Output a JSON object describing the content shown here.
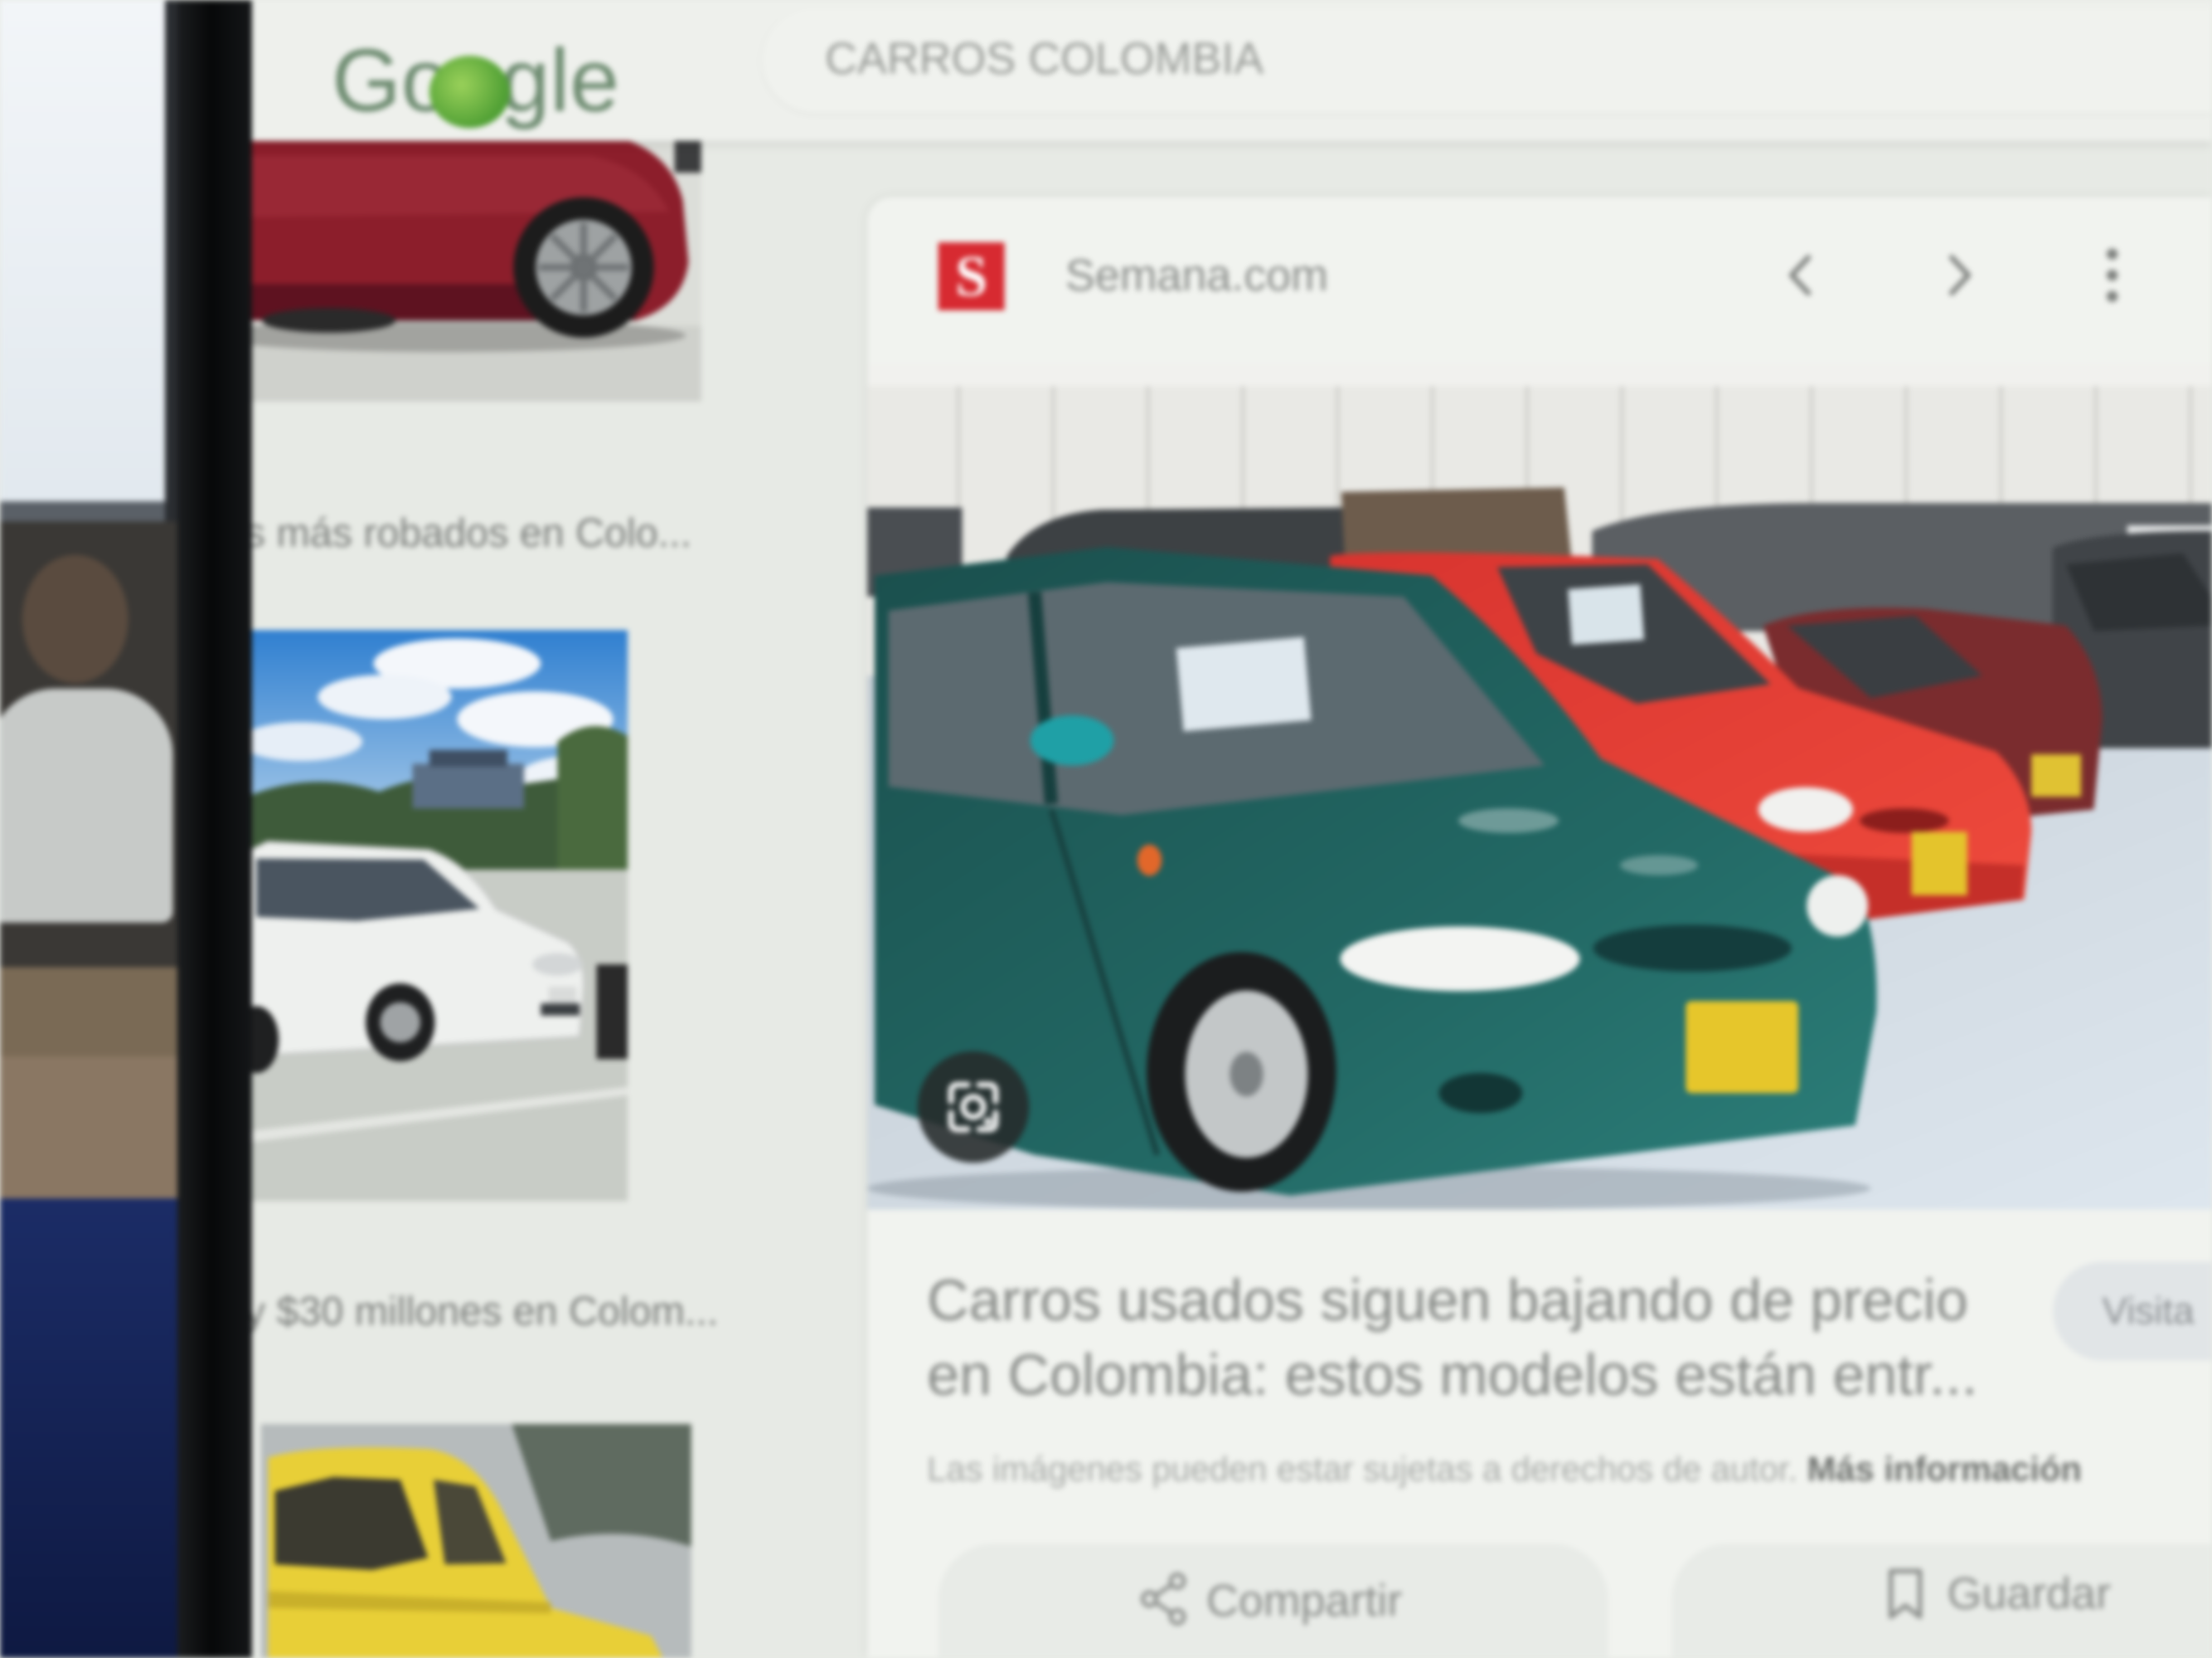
{
  "header": {
    "logo_text": "Google",
    "search_query": "CARROS COLOMBIA"
  },
  "results": [
    {
      "caption": "s más robados en Colo...",
      "car_color": "#8e1f2c"
    },
    {
      "caption": "y $30 millones en Colom...",
      "car_color": "#eeefec"
    },
    {
      "car_color": "#e8cf37"
    }
  ],
  "preview": {
    "source_logo_letter": "S",
    "source_logo_color": "#d72a31",
    "source_name": "Semana.com",
    "title_lines": [
      "Carros usados siguen bajando de precio",
      "en Colombia: estos modelos están entr..."
    ],
    "visit_label": "Visita",
    "copyright_text": "Las imágenes pueden estar sujetas a derechos de autor.",
    "more_info_label": "Más información",
    "share_label": "Compartir",
    "save_label": "Guardar"
  },
  "icons": {
    "prev": "chevron-left-icon",
    "next": "chevron-right-icon",
    "more": "more-vert-icon",
    "lens": "google-lens-icon",
    "share": "share-icon",
    "save": "bookmark-icon"
  },
  "colors": {
    "logo_green": "#6e8c71",
    "text_gray": "#878a87",
    "panel_background": "#f1f3ef"
  }
}
